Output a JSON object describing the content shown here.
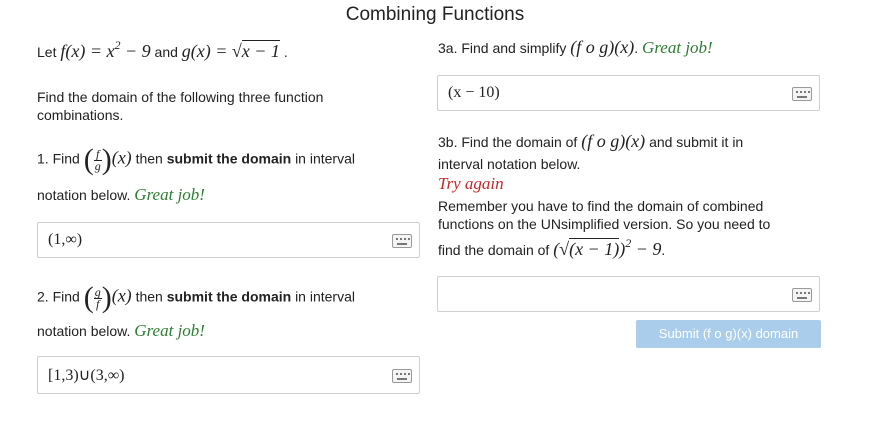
{
  "page": {
    "title": "Combining Functions"
  },
  "left": {
    "def_prefix": "Let",
    "def_f": "f(x) = x",
    "def_f_exp": "2",
    "def_f_rest": " − 9",
    "def_and": "and",
    "def_g": "g(x) = ",
    "def_g_radicand": "x − 1",
    "def_period": ".",
    "intro": "Find the domain of the following three function combinations.",
    "q1": {
      "prefix": "1. Find",
      "frac_num": "f",
      "frac_den": "g",
      "var": "(x)",
      "then": "then",
      "bold": "submit the domain",
      "after": "in interval",
      "line2": "notation below.",
      "feedback": "Great job!",
      "answer": "(1,∞)"
    },
    "q2": {
      "prefix": "2. Find",
      "frac_num": "g",
      "frac_den": "f",
      "var": "(x)",
      "then": "then",
      "bold": "submit the domain",
      "after": "in interval",
      "line2": "notation below.",
      "feedback": "Great job!",
      "answer": "[1,3)∪(3,∞)"
    }
  },
  "right": {
    "q3a": {
      "prefix": "3a. Find and simplify",
      "expr": "(f o g)(x)",
      "period": ".",
      "feedback": "Great job!",
      "answer": "(x − 10)"
    },
    "q3b": {
      "prefix": "3b. Find the domain of",
      "expr": "(f o g)(x)",
      "suffix": "and submit it in",
      "line2": "interval notation below.",
      "feedback": "Try again",
      "hint1": "Remember you have to find the domain of combined",
      "hint2": "functions on the UNsimplified version.  So you need to",
      "hint3_prefix": "find the domain of",
      "hint3_open": "(",
      "hint3_radicand": "(x − 1)",
      "hint3_close": ")",
      "hint3_exp": "2",
      "hint3_rest": " − 9",
      "hint3_period": ".",
      "answer": "",
      "submit_label": "Submit (f o g)(x) domain"
    }
  },
  "colors": {
    "correct": "#2e7d32",
    "incorrect": "#c62828",
    "submit_bg": "#a9cdea"
  }
}
